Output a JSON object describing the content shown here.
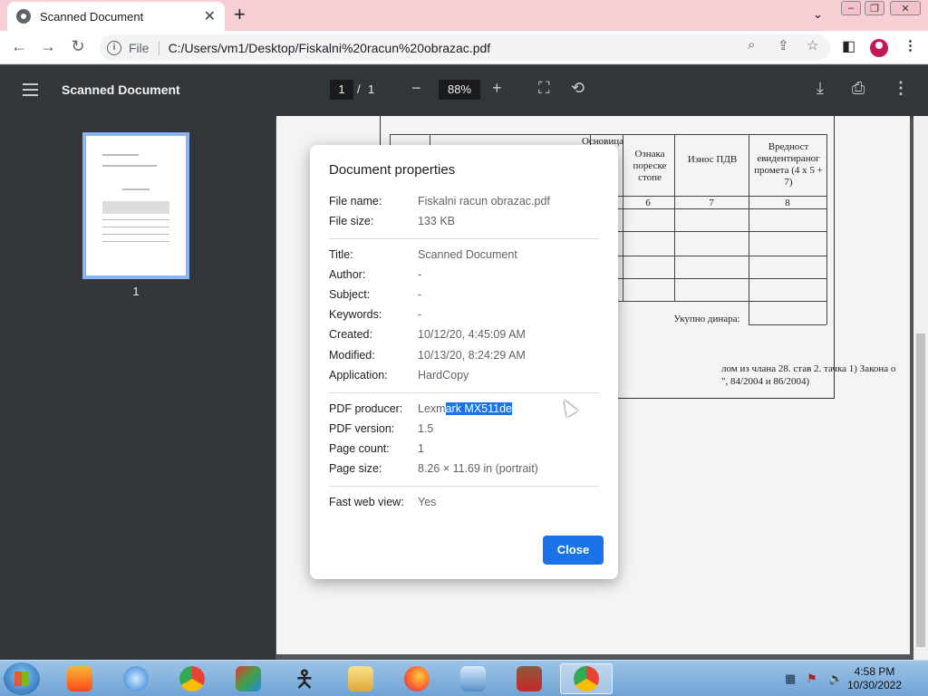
{
  "browser": {
    "tab_title": "Scanned Document",
    "tab_close": "✕",
    "new_tab": "+",
    "scheme": "File",
    "url": "C:/Users/vm1/Desktop/Fiskalni%20racun%20obrazac.pdf"
  },
  "viewer": {
    "title": "Scanned Document",
    "page_current": "1",
    "page_sep": "/",
    "page_total": "1",
    "zoom": "88%",
    "thumbnail_label": "1"
  },
  "document_snippets": {
    "col_base": "Основица",
    "col_rate": "Ознака пореске стопе",
    "col_vat": "Износ ПДВ",
    "col_value": "Вредност евидентираног промета (4 x 5 + 7)",
    "num6": "6",
    "num7": "7",
    "num8": "8",
    "total": "Укупно динара:",
    "footer1": "лом из члана 28. став 2. тачка 1) Закона о",
    "footer2": "\", 84/2004 и 86/2004)"
  },
  "dialog": {
    "title": "Document properties",
    "file_name_label": "File name:",
    "file_name": "Fiskalni racun obrazac.pdf",
    "file_size_label": "File size:",
    "file_size": "133 KB",
    "title_label": "Title:",
    "doc_title": "Scanned Document",
    "author_label": "Author:",
    "author": "-",
    "subject_label": "Subject:",
    "subject": "-",
    "keywords_label": "Keywords:",
    "keywords": "-",
    "created_label": "Created:",
    "created": "10/12/20, 4:45:09 AM",
    "modified_label": "Modified:",
    "modified": "10/13/20, 8:24:29 AM",
    "application_label": "Application:",
    "application": "HardCopy",
    "producer_label": "PDF producer:",
    "producer_plain": "Lexm",
    "producer_selected": "ark MX511de",
    "version_label": "PDF version:",
    "version": "1.5",
    "page_count_label": "Page count:",
    "page_count": "1",
    "page_size_label": "Page size:",
    "page_size": "8.26 × 11.69 in (portrait)",
    "fast_web_label": "Fast web view:",
    "fast_web": "Yes",
    "close_label": "Close"
  },
  "taskbar": {
    "time": "4:58 PM",
    "date": "10/30/2022",
    "active_app": "chrome"
  },
  "colors": {
    "tabstrip": "#f9cfd6",
    "accent": "#1a73e8",
    "viewer_toolbar": "#323639"
  }
}
